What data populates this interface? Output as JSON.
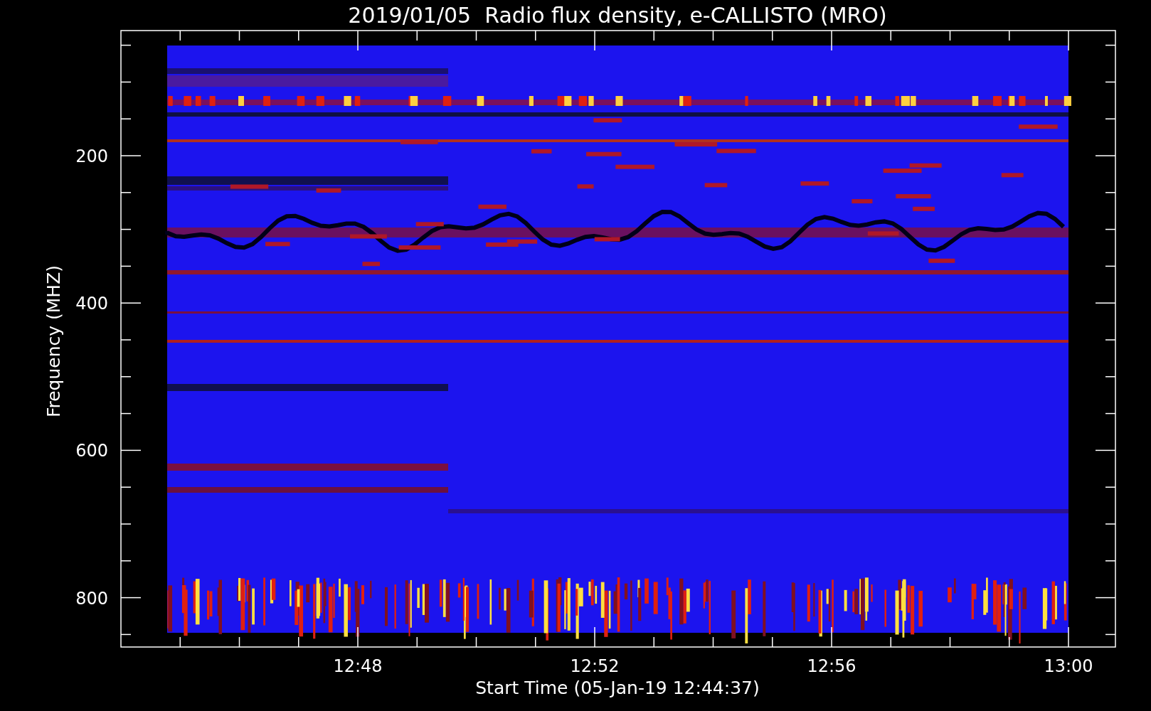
{
  "title": "2019/01/05  Radio flux density, e-CALLISTO (MRO)",
  "y_axis": {
    "label": "Frequency (MHZ)",
    "ticks": [
      "200",
      "400",
      "600",
      "800"
    ]
  },
  "x_axis": {
    "label": "Start Time (05-Jan-19 12:44:37)",
    "ticks": [
      "12:48",
      "12:52",
      "12:56",
      "13:00"
    ]
  }
}
